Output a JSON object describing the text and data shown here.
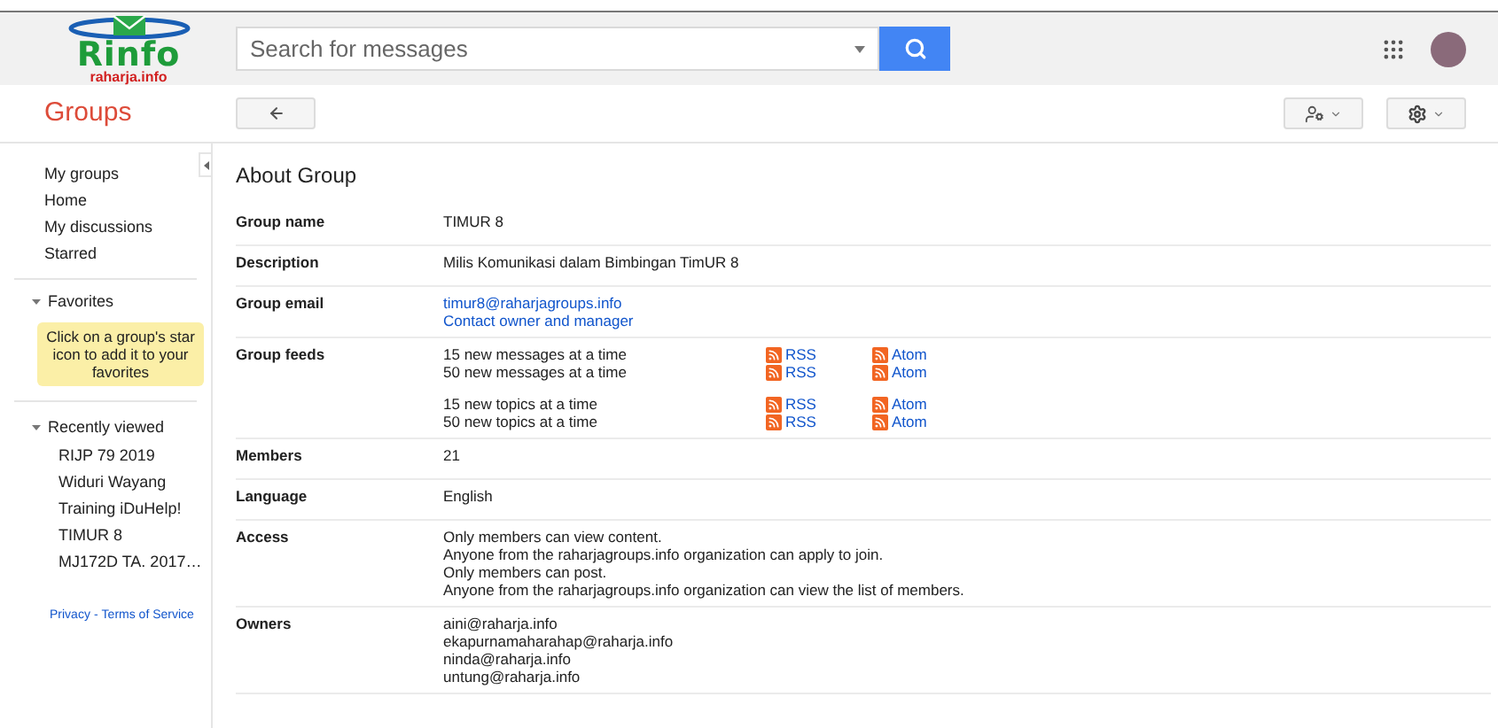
{
  "logo": {
    "name": "Rinfo",
    "subtitle": "raharja.info"
  },
  "search": {
    "placeholder": "Search for messages"
  },
  "app_title": "Groups",
  "sidebar": {
    "items": [
      {
        "label": "My groups"
      },
      {
        "label": "Home"
      },
      {
        "label": "My discussions"
      },
      {
        "label": "Starred"
      }
    ],
    "favorites": {
      "title": "Favorites",
      "expanded": true,
      "hint": "Click on a group's star icon to add it to your favorites"
    },
    "recent": {
      "title": "Recently viewed",
      "expanded": true,
      "items": [
        "RIJP 79 2019",
        "Widuri Wayang",
        "Training iDuHelp!",
        "TIMUR 8",
        "MJ172D TA. 2017…"
      ]
    },
    "footer": {
      "privacy": "Privacy",
      "separator": "-",
      "terms": "Terms of Service"
    }
  },
  "page_title": "About Group",
  "rows": [
    {
      "kind": "text",
      "label": "Group name",
      "lines": [
        "TIMUR 8"
      ]
    },
    {
      "kind": "text",
      "label": "Description",
      "lines": [
        "Milis Komunikasi dalam Bimbingan TimUR 8"
      ]
    },
    {
      "kind": "links",
      "label": "Group email",
      "lines": [
        "timur8@raharjagroups.info",
        "Contact owner and manager"
      ]
    },
    {
      "kind": "feeds",
      "label": "Group feeds",
      "groups": [
        [
          {
            "label": "15 new messages at a time",
            "rss": "RSS",
            "atom": "Atom"
          },
          {
            "label": "50 new messages at a time",
            "rss": "RSS",
            "atom": "Atom"
          }
        ],
        [
          {
            "label": "15 new topics at a time",
            "rss": "RSS",
            "atom": "Atom"
          },
          {
            "label": "50 new topics at a time",
            "rss": "RSS",
            "atom": "Atom"
          }
        ]
      ]
    },
    {
      "kind": "text",
      "label": "Members",
      "lines": [
        "21"
      ]
    },
    {
      "kind": "text",
      "label": "Language",
      "lines": [
        "English"
      ]
    },
    {
      "kind": "text",
      "label": "Access",
      "lines": [
        "Only members can view content.",
        "Anyone from the raharjagroups.info organization can apply to join.",
        "Only members can post.",
        "Anyone from the raharjagroups.info organization can view the list of members."
      ]
    },
    {
      "kind": "text",
      "label": "Owners",
      "lines": [
        "aini@raharja.info",
        "ekapurnamaharahap@raharja.info",
        "ninda@raharja.info",
        "untung@raharja.info"
      ]
    }
  ]
}
